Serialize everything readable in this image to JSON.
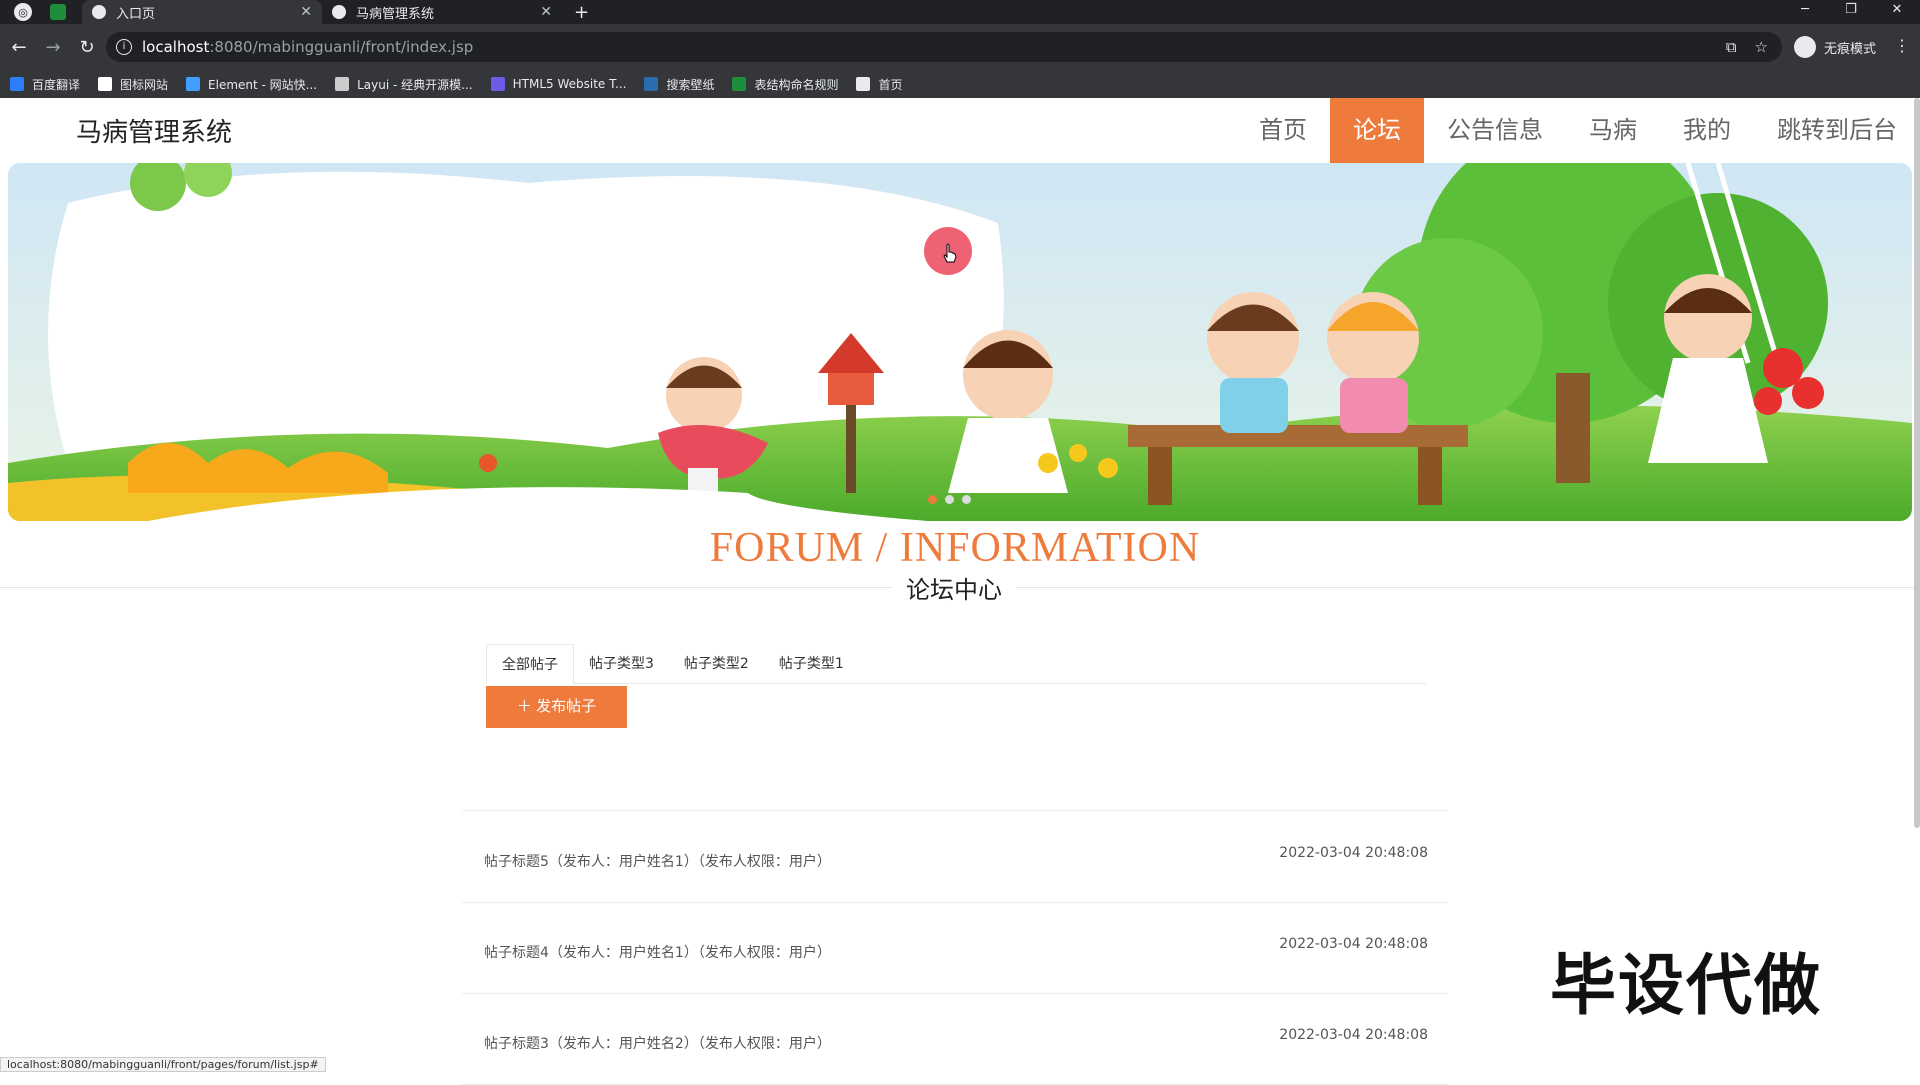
{
  "browser": {
    "tabs": [
      {
        "title": "入口页",
        "active": true
      },
      {
        "title": "马病管理系统",
        "active": false
      }
    ],
    "url_host": "localhost",
    "url_path": ":8080/mabingguanli/front/index.jsp",
    "profile_label": "无痕模式",
    "bookmarks": [
      {
        "label": "百度翻译",
        "icon": "translate-icon",
        "color": "#2d7ff9"
      },
      {
        "label": "图标网站",
        "icon": "flag-icon",
        "color": "#ffffff"
      },
      {
        "label": "Element - 网站快...",
        "icon": "element-icon",
        "color": "#409eff"
      },
      {
        "label": "Layui - 经典开源模...",
        "icon": "layui-icon",
        "color": "#cccccc"
      },
      {
        "label": "HTML5 Website T...",
        "icon": "html5-icon",
        "color": "#6c5ce7"
      },
      {
        "label": "搜索壁纸",
        "icon": "wallpaper-icon",
        "color": "#2b6cb0"
      },
      {
        "label": "表结构命名规则",
        "icon": "sheet-icon",
        "color": "#1e8e3e"
      },
      {
        "label": "首页",
        "icon": "globe-icon",
        "color": "#e8eaed"
      }
    ],
    "status_url": "localhost:8080/mabingguanli/front/pages/forum/list.jsp#"
  },
  "site": {
    "title": "马病管理系统",
    "nav": [
      {
        "label": "首页",
        "active": false
      },
      {
        "label": "论坛",
        "active": true
      },
      {
        "label": "公告信息",
        "active": false
      },
      {
        "label": "马病",
        "active": false
      },
      {
        "label": "我的",
        "active": false
      },
      {
        "label": "跳转到后台",
        "active": false
      }
    ],
    "accent": "#ee7a3c"
  },
  "section": {
    "title_en": "FORUM / INFORMATION",
    "title_cn": "论坛中心"
  },
  "forum": {
    "tabs": [
      "全部帖子",
      "帖子类型3",
      "帖子类型2",
      "帖子类型1"
    ],
    "active_tab": 0,
    "publish_label": "发布帖子",
    "posts": [
      {
        "title": "帖子标题5（发布人：用户姓名1）（发布人权限：用户）",
        "date": "2022-03-04 20:48:08"
      },
      {
        "title": "帖子标题4（发布人：用户姓名1）（发布人权限：用户）",
        "date": "2022-03-04 20:48:08"
      },
      {
        "title": "帖子标题3（发布人：用户姓名2）（发布人权限：用户）",
        "date": "2022-03-04 20:48:08"
      }
    ]
  },
  "watermark": "毕设代做"
}
